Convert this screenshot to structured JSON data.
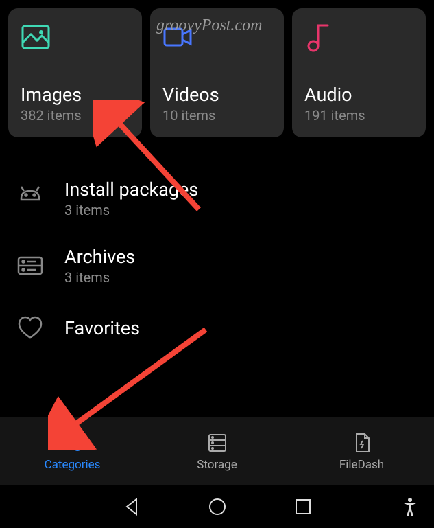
{
  "watermark": "groovyPost.com",
  "cards": [
    {
      "title": "Images",
      "subtitle": "382 items"
    },
    {
      "title": "Videos",
      "subtitle": "10 items"
    },
    {
      "title": "Audio",
      "subtitle": "191 items"
    }
  ],
  "list": [
    {
      "title": "Install packages",
      "subtitle": "3 items"
    },
    {
      "title": "Archives",
      "subtitle": "3 items"
    },
    {
      "title": "Favorites",
      "subtitle": ""
    }
  ],
  "nav": [
    {
      "label": "Categories"
    },
    {
      "label": "Storage"
    },
    {
      "label": "FileDash"
    }
  ]
}
